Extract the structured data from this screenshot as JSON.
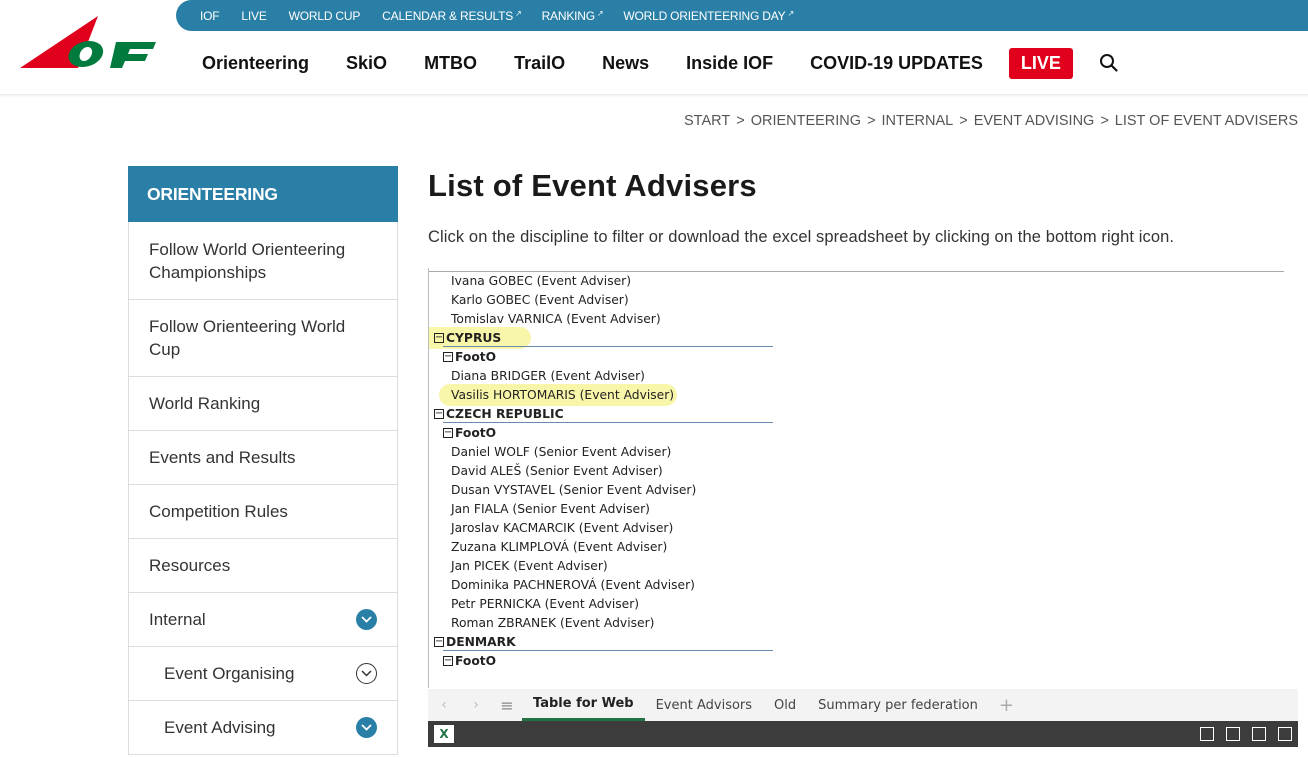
{
  "topbar": {
    "links": [
      {
        "label": "IOF",
        "ext": ""
      },
      {
        "label": "LIVE",
        "ext": ""
      },
      {
        "label": "WORLD CUP",
        "ext": ""
      },
      {
        "label": "CALENDAR & RESULTS",
        "ext": "↗"
      },
      {
        "label": "RANKING",
        "ext": "↗"
      },
      {
        "label": "WORLD ORIENTEERING DAY",
        "ext": "↗"
      }
    ]
  },
  "logo": {
    "text": "IOF",
    "colors": {
      "red": "#e0001b",
      "green": "#007a3d"
    }
  },
  "mainnav": {
    "items": [
      "Orienteering",
      "SkiO",
      "MTBO",
      "TrailO",
      "News",
      "Inside IOF",
      "COVID-19 UPDATES"
    ],
    "live_label": "LIVE",
    "search_icon": "search-icon"
  },
  "breadcrumb": [
    "START",
    "ORIENTEERING",
    "INTERNAL",
    "EVENT ADVISING",
    "LIST OF EVENT ADVISERS"
  ],
  "sidebar": {
    "title": "ORIENTEERING",
    "items": [
      {
        "label": "Follow World Orienteering Championships"
      },
      {
        "label": "Follow Orienteering World Cup"
      },
      {
        "label": "World Ranking"
      },
      {
        "label": "Events and Results"
      },
      {
        "label": "Competition Rules"
      },
      {
        "label": "Resources"
      },
      {
        "label": "Internal"
      },
      {
        "label": "Event Organising"
      },
      {
        "label": "Event Advising"
      }
    ]
  },
  "page": {
    "title": "List of Event Advisers",
    "intro": "Click on the discipline to filter or download the excel spreadsheet by clicking on the bottom right icon."
  },
  "sheet": {
    "rows": [
      {
        "type": "person",
        "text": "Ivana GOBEC (Event Adviser)"
      },
      {
        "type": "person",
        "text": "Karlo GOBEC (Event Adviser)"
      },
      {
        "type": "person",
        "text": "Tomislav VARNICA (Event Adviser)"
      },
      {
        "type": "country",
        "text": "CYPRUS"
      },
      {
        "type": "disc",
        "text": "FootO"
      },
      {
        "type": "person",
        "text": "Diana BRIDGER (Event Adviser)"
      },
      {
        "type": "person",
        "text": "Vasilis HORTOMARIS (Event Adviser)"
      },
      {
        "type": "country",
        "text": "CZECH REPUBLIC"
      },
      {
        "type": "disc",
        "text": "FootO"
      },
      {
        "type": "person",
        "text": "Daniel WOLF (Senior Event Adviser)"
      },
      {
        "type": "person",
        "text": "David ALEŠ (Senior Event Adviser)"
      },
      {
        "type": "person",
        "text": "Dusan VYSTAVEL (Senior Event Adviser)"
      },
      {
        "type": "person",
        "text": "Jan FIALA (Senior Event Adviser)"
      },
      {
        "type": "person",
        "text": "Jaroslav KACMARCIK (Event Adviser)"
      },
      {
        "type": "person",
        "text": "Zuzana KLIMPLOVÁ (Event Adviser)"
      },
      {
        "type": "person",
        "text": "Jan PICEK (Event Adviser)"
      },
      {
        "type": "person",
        "text": "Dominika PACHNEROVÁ (Event Adviser)"
      },
      {
        "type": "person",
        "text": "Petr PERNICKA (Event Adviser)"
      },
      {
        "type": "person",
        "text": "Roman ZBRANEK (Event Adviser)"
      },
      {
        "type": "country",
        "text": "DENMARK"
      },
      {
        "type": "disc",
        "text": "FootO"
      }
    ],
    "collapse_glyph": "−",
    "tabs": [
      "Table for Web",
      "Event Advisors",
      "Old",
      "Summary per federation"
    ],
    "add_tab": "+",
    "excel_icon": "X"
  }
}
